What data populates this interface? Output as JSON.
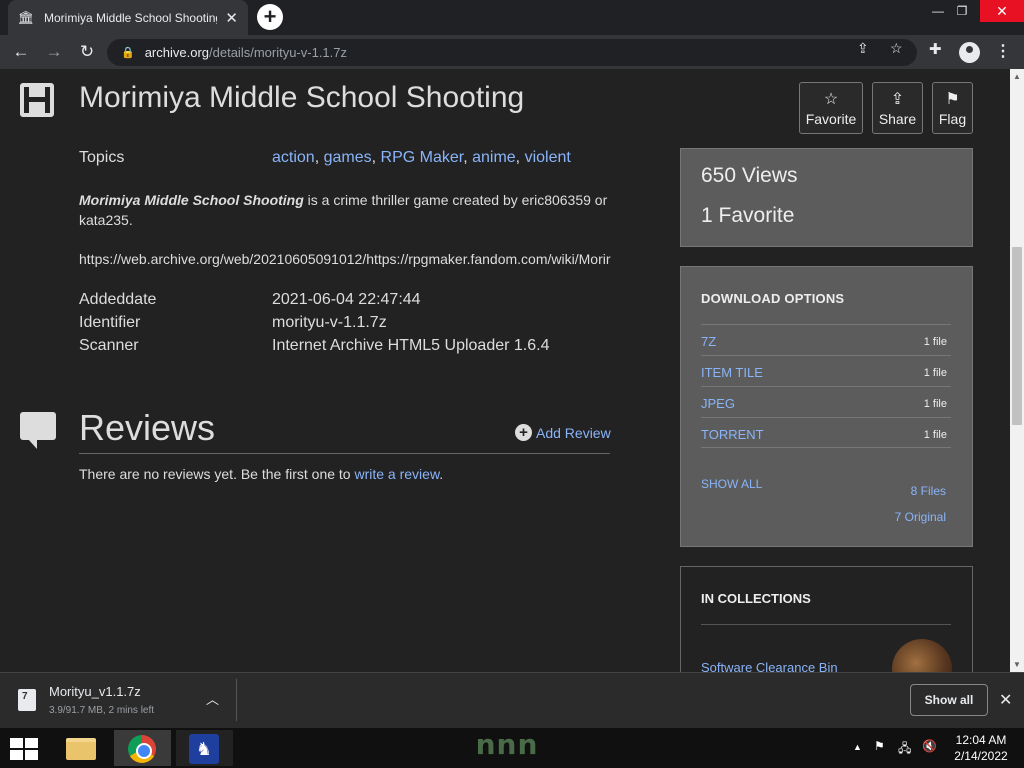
{
  "browser": {
    "tab_title": "Morimiya Middle School Shooting",
    "tab_close": "✕",
    "new_tab": "+",
    "window_min": "—",
    "window_max": "❐",
    "window_close": "✕",
    "url_host": "archive.org",
    "url_path": "/details/morityu-v-1.1.7z",
    "icons": {
      "back": "back-arrow-icon",
      "forward": "forward-arrow-icon",
      "reload": "reload-icon",
      "lock": "lock-icon",
      "share": "share-icon",
      "bookmark": "star-icon",
      "extensions": "puzzle-icon",
      "profile": "profile-icon",
      "menu": "kebab-menu-icon"
    }
  },
  "item": {
    "title": "Morimiya Middle School Shooting",
    "actions": [
      {
        "label": "Favorite",
        "icon": "star-icon"
      },
      {
        "label": "Share",
        "icon": "share-icon"
      },
      {
        "label": "Flag",
        "icon": "flag-icon"
      }
    ],
    "topics_label": "Topics",
    "topics": [
      "action",
      "games",
      "RPG Maker",
      "anime",
      "violent"
    ],
    "description_title": "Morimiya Middle School Shooting",
    "description_rest": " is a crime thriller game created by eric806359 or kata235.",
    "description_url": "https://web.archive.org/web/20210605091012/https://rpgmaker.fandom.com/wiki/Morir",
    "meta": [
      {
        "label": "Addeddate",
        "value": "2021-06-04 22:47:44"
      },
      {
        "label": "Identifier",
        "value": "morityu-v-1.1.7z"
      },
      {
        "label": "Scanner",
        "value": "Internet Archive HTML5 Uploader 1.6.4"
      }
    ]
  },
  "reviews": {
    "title": "Reviews",
    "add_label": "Add Review",
    "empty_text": "There are no reviews yet. Be the first one to ",
    "empty_link": "write a review",
    "empty_end": "."
  },
  "stats": {
    "views": "650 Views",
    "favorites": "1 Favorite"
  },
  "downloads": {
    "heading": "DOWNLOAD OPTIONS",
    "rows": [
      {
        "format": "7Z",
        "count": "1 file"
      },
      {
        "format": "ITEM TILE",
        "count": "1 file"
      },
      {
        "format": "JPEG",
        "count": "1 file"
      },
      {
        "format": "TORRENT",
        "count": "1 file"
      }
    ],
    "show_all": "SHOW ALL",
    "files_count": "8 Files",
    "original_count": "7 Original"
  },
  "collections": {
    "heading": "IN COLLECTIONS",
    "first": "Software Clearance Bin"
  },
  "shelf": {
    "file_name": "Morityu_v1.1.7z",
    "status": "3.9/91.7 MB, 2 mins left",
    "show_all": "Show all",
    "close": "✕"
  },
  "taskbar": {
    "watermark": "nnn",
    "time": "12:04 AM",
    "date": "2/14/2022"
  }
}
